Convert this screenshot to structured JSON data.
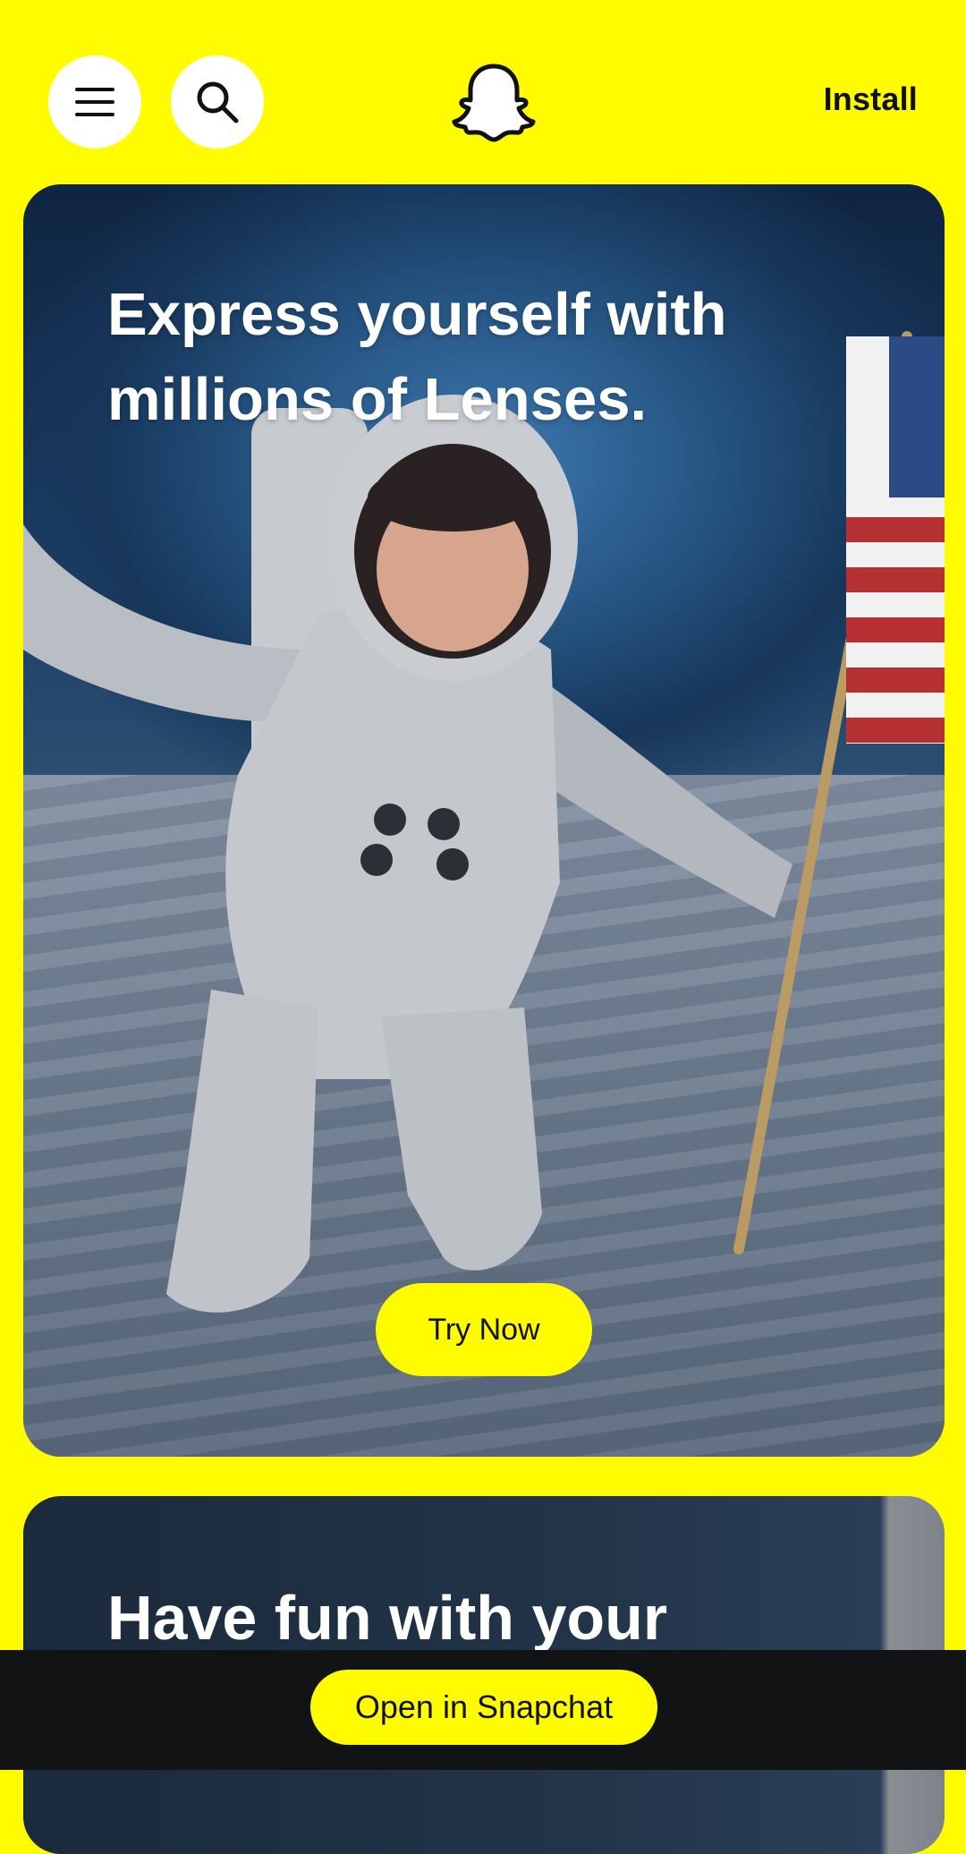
{
  "header": {
    "menu_icon": "hamburger-menu-icon",
    "search_icon": "search-icon",
    "logo_icon": "snapchat-ghost-logo",
    "install_label": "Install"
  },
  "cards": [
    {
      "title": "Express yourself with millions of Lenses.",
      "button_label": "Try Now"
    },
    {
      "title": "Have fun with your"
    }
  ],
  "bottom_bar": {
    "open_label": "Open in Snapchat"
  },
  "colors": {
    "brand_yellow": "#FFFC00",
    "bottom_bar": "#121315",
    "text_dark": "#111111",
    "white": "#FFFFFF"
  }
}
